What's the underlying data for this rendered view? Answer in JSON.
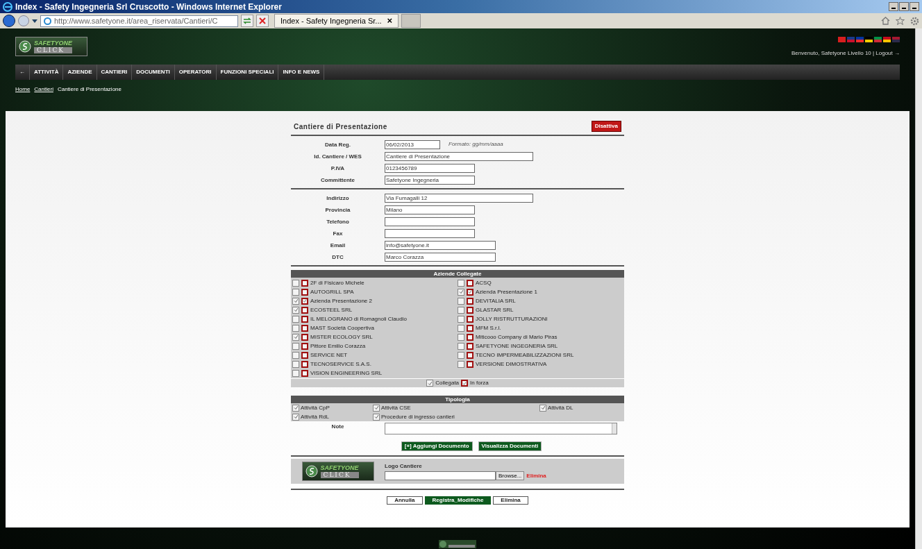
{
  "window": {
    "title": "Index - Safety Ingegneria Srl Cruscotto - Windows Internet Explorer"
  },
  "browser": {
    "address": "http://www.safetyone.it/area_riservata/Cantieri/C",
    "tab": {
      "label": "Index - Safety Ingegneria Sr...",
      "close": "×"
    }
  },
  "header": {
    "logo": {
      "top": "SAFETYONE",
      "bottom": "CLICK"
    },
    "user_line": "Benvenuto, Safetyone Livello 10 | Logout →"
  },
  "nav": [
    {
      "label": "←"
    },
    {
      "label": "ATTIVITÀ"
    },
    {
      "label": "AZIENDE"
    },
    {
      "label": "CANTIERI"
    },
    {
      "label": "DOCUMENTI"
    },
    {
      "label": "OPERATORI"
    },
    {
      "label": "FUNZIONI SPECIALI"
    },
    {
      "label": "INFO E NEWS"
    }
  ],
  "breadcrumb": [
    {
      "label": "Home",
      "link": true
    },
    {
      "label": "Cantieri",
      "link": true
    },
    {
      "label": "Cantiere di Presentazione",
      "link": false
    }
  ],
  "form": {
    "title": "Cantiere di Presentazione",
    "deactivate": "Disattiva",
    "section1": [
      {
        "label": "Data Reg.",
        "value": "06/02/2013",
        "hint": "Formato: gg/mm/aaaa"
      },
      {
        "label": "Id. Cantiere / WES",
        "value": "Cantiere di Presentazione"
      },
      {
        "label": "P.IVA",
        "value": "0123456789"
      },
      {
        "label": "Committente",
        "value": "Safetyone Ingegneria"
      }
    ],
    "section2": [
      {
        "label": "Indirizzo",
        "value": "Via Fumagalli 12"
      },
      {
        "label": "Provincia",
        "value": "Milano"
      },
      {
        "label": "Telefono"
      },
      {
        "label": "Fax"
      },
      {
        "label": "Email",
        "value": "info@safetyone.it"
      },
      {
        "label": "DTC",
        "value": "Marco Corazza"
      }
    ],
    "aziende": {
      "title": "Aziende Collegate",
      "left": [
        {
          "name": "2F di Fisicaro Michele",
          "collegata": false,
          "in_forza": false
        },
        {
          "name": "AUTOGRILL SPA",
          "collegata": false,
          "in_forza": false
        },
        {
          "name": "Azienda Presentazione 2",
          "collegata": true,
          "in_forza": true
        },
        {
          "name": "ECOSTEEL SRL",
          "collegata": true,
          "in_forza": false
        },
        {
          "name": "IL MELOGRANO di Romagnoli Claudio",
          "collegata": false,
          "in_forza": false
        },
        {
          "name": "MAST Società Coopertiva",
          "collegata": false,
          "in_forza": false
        },
        {
          "name": "MISTER ECOLOGY SRL",
          "collegata": true,
          "in_forza": false
        },
        {
          "name": "Pittore Emilio Corazza",
          "collegata": false,
          "in_forza": false
        },
        {
          "name": "SERVICE NET",
          "collegata": false,
          "in_forza": false
        },
        {
          "name": "TECNOSERVICE S.A.S.",
          "collegata": false,
          "in_forza": false
        },
        {
          "name": "VISION ENGINEERING SRL",
          "collegata": false,
          "in_forza": false
        }
      ],
      "right": [
        {
          "name": "ACSQ",
          "collegata": false,
          "in_forza": false
        },
        {
          "name": "Azienda Presentazione 1",
          "collegata": true,
          "in_forza": true
        },
        {
          "name": "DEVITALIA SRL",
          "collegata": false,
          "in_forza": false
        },
        {
          "name": "GLASTAR SRL",
          "collegata": false,
          "in_forza": false
        },
        {
          "name": "JOLLY RISTRUTTURAZIONI",
          "collegata": false,
          "in_forza": false
        },
        {
          "name": "MFM S.r.l.",
          "collegata": false,
          "in_forza": false
        },
        {
          "name": "Miticooo Company di Mario Piras",
          "collegata": false,
          "in_forza": false
        },
        {
          "name": "SAFETYONE INGEGNERIA SRL",
          "collegata": false,
          "in_forza": false
        },
        {
          "name": "TECNO IMPERMEABILIZZAZIONI SRL",
          "collegata": false,
          "in_forza": false
        },
        {
          "name": "VERSIONE DIMOSTRATIVA",
          "collegata": false,
          "in_forza": false
        }
      ],
      "legend": [
        {
          "label": "Collegata",
          "kind": "gray",
          "checked": true
        },
        {
          "label": "In forza",
          "kind": "red",
          "checked": true
        }
      ]
    },
    "tipologia": {
      "title": "Tipologia",
      "items": [
        {
          "label": "Attività CpP",
          "checked": true
        },
        {
          "label": "Attività CSE",
          "checked": true
        },
        {
          "label": "Attività DL",
          "checked": true
        },
        {
          "label": "Attività RdL",
          "checked": true
        },
        {
          "label": "Procedure di ingresso cantieri",
          "checked": true
        }
      ]
    },
    "note_label": "Note",
    "doc_buttons": [
      "[+] Aggiungi Documento",
      "Visualizza Documenti"
    ],
    "logo_section": {
      "label": "Logo Cantiere",
      "browse": "Browse...",
      "delete": "Elimina",
      "logo": {
        "top": "SAFETYONE",
        "bottom": "CLICK"
      }
    },
    "actions": [
      {
        "label": "Annulla",
        "primary": false
      },
      {
        "label": "Registra_Modifiche",
        "primary": true
      },
      {
        "label": "Elimina",
        "primary": false
      }
    ]
  }
}
